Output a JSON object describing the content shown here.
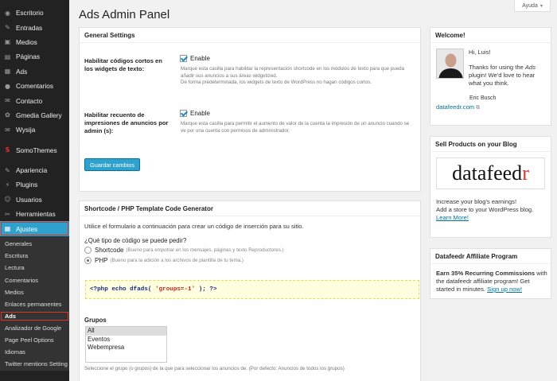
{
  "sidebar": {
    "top": [
      {
        "label": "Escritorio",
        "icon": "dashboard-icon",
        "glyph": "◉"
      },
      {
        "label": "Entradas",
        "icon": "pin-icon",
        "glyph": "✎"
      },
      {
        "label": "Medios",
        "icon": "media-icon",
        "glyph": "▣"
      },
      {
        "label": "Páginas",
        "icon": "pages-icon",
        "glyph": "▤"
      },
      {
        "label": "Ads",
        "icon": "ads-icon",
        "glyph": "▦"
      },
      {
        "label": "Comentarios",
        "icon": "comments-icon",
        "glyph": "●"
      },
      {
        "label": "Contacto",
        "icon": "contact-icon",
        "glyph": "✉"
      },
      {
        "label": "Gmedia Gallery",
        "icon": "gallery-icon",
        "glyph": "✿"
      },
      {
        "label": "Wysija",
        "icon": "wysija-icon",
        "glyph": "✉"
      }
    ],
    "mid": [
      {
        "label": "SomoThemes",
        "icon": "somothemes-icon",
        "glyph": "S"
      }
    ],
    "bottom": [
      {
        "label": "Apariencia",
        "icon": "appearance-icon",
        "glyph": "✎"
      },
      {
        "label": "Plugins",
        "icon": "plugins-icon",
        "glyph": "⚡"
      },
      {
        "label": "Usuarios",
        "icon": "users-icon",
        "glyph": "☺"
      },
      {
        "label": "Herramientas",
        "icon": "tools-icon",
        "glyph": "✂"
      },
      {
        "label": "Ajustes",
        "icon": "settings-icon",
        "glyph": "▦",
        "active": true
      }
    ],
    "submenu": [
      "Generales",
      "Escritura",
      "Lectura",
      "Comentarios",
      "Medios",
      "Enlaces permanentes",
      "Ads",
      "Analizador de Google",
      "Page Peel Options",
      "Idiomas",
      "Twitter mentions Setting"
    ],
    "current_sub": "Ads"
  },
  "header": {
    "title": "Ads Admin Panel",
    "help": "Ayuda",
    "help_caret": "▾"
  },
  "general": {
    "title": "General Settings",
    "row1": {
      "label": "Habilitar códigos cortos en los widgets de texto:",
      "option": "Enable",
      "desc1": "Marque esta casilla para habilitar la representación shortcode en los módulos de texto para que pueda añadir sus anuncios a sus áreas widgetized.",
      "desc2": "De forma predeterminada, los widgets de texto de WordPress no hagan códigos cortos."
    },
    "row2": {
      "label": "Habilitar recuento de impresiones de anuncios por admin (s):",
      "option": "Enable",
      "desc": "Marque esta casilla para permitir el aumento de valor de la cuenta la impresión de un anuncio cuando se ve por una cuenta con permisos de administrador."
    },
    "save": "Guardar cambios"
  },
  "generator": {
    "title": "Shortcode / PHP Template Code Generator",
    "intro": "Utilice el formulario a continuación para crear un código de inserción para su sitio.",
    "question": "¿Qué tipo de código se puede pedir?",
    "opt1": "Shortcode",
    "opt1_hint": "(Bueno para empotrar en los mensajes, páginas y texto Reproductores.)",
    "opt2": "PHP",
    "opt2_hint": "(Bueno para la adición a los archivos de plantilla de tu tema.)",
    "code_a": "<?php echo dfads( ",
    "code_b": "'groups=-1'",
    "code_c": " ); ?>",
    "groups_label": "Grupos",
    "groups": [
      "All",
      "Eventos",
      "Webempresa"
    ],
    "groups_hint": "Seleccione el grupo (o grupos) de la que para seleccionar los anuncios de. (Por defecto: Anuncios de todos los grupos)"
  },
  "welcome": {
    "title": "Welcome!",
    "greeting": "Hi, Luis!",
    "text_a": "Thanks for using the ",
    "text_em": "Ads",
    "text_b": " plugin! We'd love to hear what you think.",
    "signature": "Eric Busch",
    "link": "datafeedr.com",
    "ext": "⧉"
  },
  "sell": {
    "title": "Sell Products on your Blog",
    "logo_a": "datafeed",
    "logo_b": "r",
    "l1": "Increase your blog's earnings!",
    "l2": "Add a store to your WordPress blog.",
    "link": "Learn More!"
  },
  "affiliate": {
    "title": "Datafeedr Affiliate Program",
    "bold": "Earn 35% Recurring Commissions",
    "text": " with the datafeedr affiliate program! Get started in minutes. ",
    "link": "Sign up now!"
  },
  "colors": {
    "accent": "#2ea2cc",
    "sidebar": "#222222",
    "highlight": "#d9352a",
    "logo_red": "#d9352a"
  }
}
